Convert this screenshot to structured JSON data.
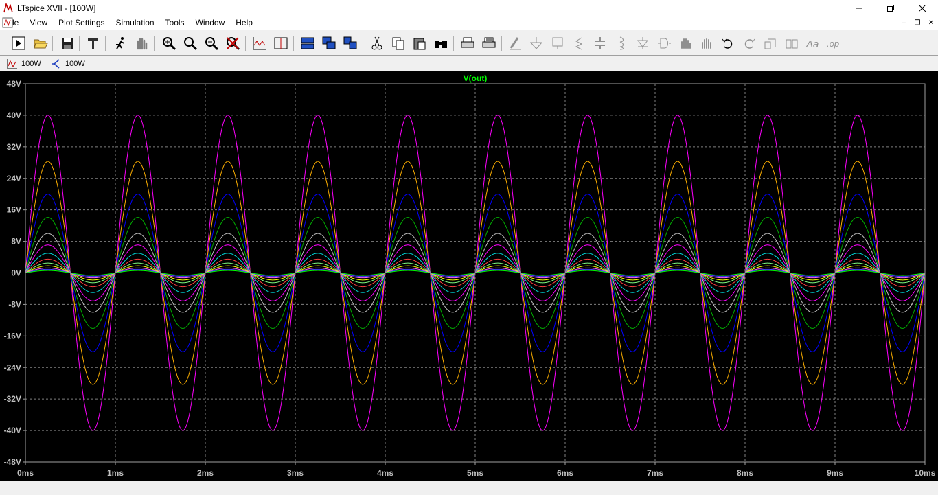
{
  "window": {
    "title": "LTspice XVII - [100W]"
  },
  "menu": {
    "items": [
      "File",
      "View",
      "Plot Settings",
      "Simulation",
      "Tools",
      "Window",
      "Help"
    ]
  },
  "toolbar": {
    "buttons": [
      "run",
      "open",
      "save",
      "settings",
      "probe",
      "pan",
      "zoom-in",
      "zoom-out-1",
      "zoom-out-2",
      "zoom-cancel",
      "autorange",
      "ruler",
      "tile-h",
      "cascade",
      "tile-v",
      "cut",
      "copy",
      "paste",
      "find",
      "print",
      "print-setup",
      "wire",
      "ground",
      "label",
      "resistor",
      "capacitor",
      "inductor",
      "diode",
      "component",
      "move",
      "drag",
      "undo",
      "redo",
      "rotate",
      "mirror",
      "text",
      "spice-directive"
    ]
  },
  "tabs": [
    {
      "label": "100W",
      "icon": "waveform-icon"
    },
    {
      "label": "100W",
      "icon": "schematic-icon"
    }
  ],
  "colors": {
    "background": "#000000",
    "grid": "#808080",
    "text": "#c0c0c0",
    "trace_title": "#00ff00"
  },
  "chart_data": {
    "type": "line",
    "title": "V(out)",
    "xlabel": "",
    "ylabel": "",
    "x_ticks": [
      "0ms",
      "1ms",
      "2ms",
      "3ms",
      "4ms",
      "5ms",
      "6ms",
      "7ms",
      "8ms",
      "9ms",
      "10ms"
    ],
    "y_ticks": [
      "48V",
      "40V",
      "32V",
      "24V",
      "16V",
      "8V",
      "0V",
      "-8V",
      "-16V",
      "-24V",
      "-32V",
      "-40V",
      "-48V"
    ],
    "xlim": [
      0,
      10
    ],
    "ylim": [
      -48,
      48
    ],
    "x_unit": "ms",
    "frequency_hz": 1000,
    "grid": true,
    "series": [
      {
        "amplitude": 40.0,
        "color": "#ff00ff"
      },
      {
        "amplitude": 28.3,
        "color": "#ffb000"
      },
      {
        "amplitude": 20.0,
        "color": "#0000ff"
      },
      {
        "amplitude": 14.1,
        "color": "#00b000"
      },
      {
        "amplitude": 10.0,
        "color": "#c0c0c0"
      },
      {
        "amplitude": 7.1,
        "color": "#ff00ff"
      },
      {
        "amplitude": 5.0,
        "color": "#00e0e0"
      },
      {
        "amplitude": 3.5,
        "color": "#ff4040"
      },
      {
        "amplitude": 2.5,
        "color": "#80ff80"
      },
      {
        "amplitude": 1.8,
        "color": "#ffff00"
      },
      {
        "amplitude": 1.25,
        "color": "#ff60ff"
      },
      {
        "amplitude": 0.9,
        "color": "#4040ff"
      },
      {
        "amplitude": 0.6,
        "color": "#00ff00"
      }
    ]
  }
}
